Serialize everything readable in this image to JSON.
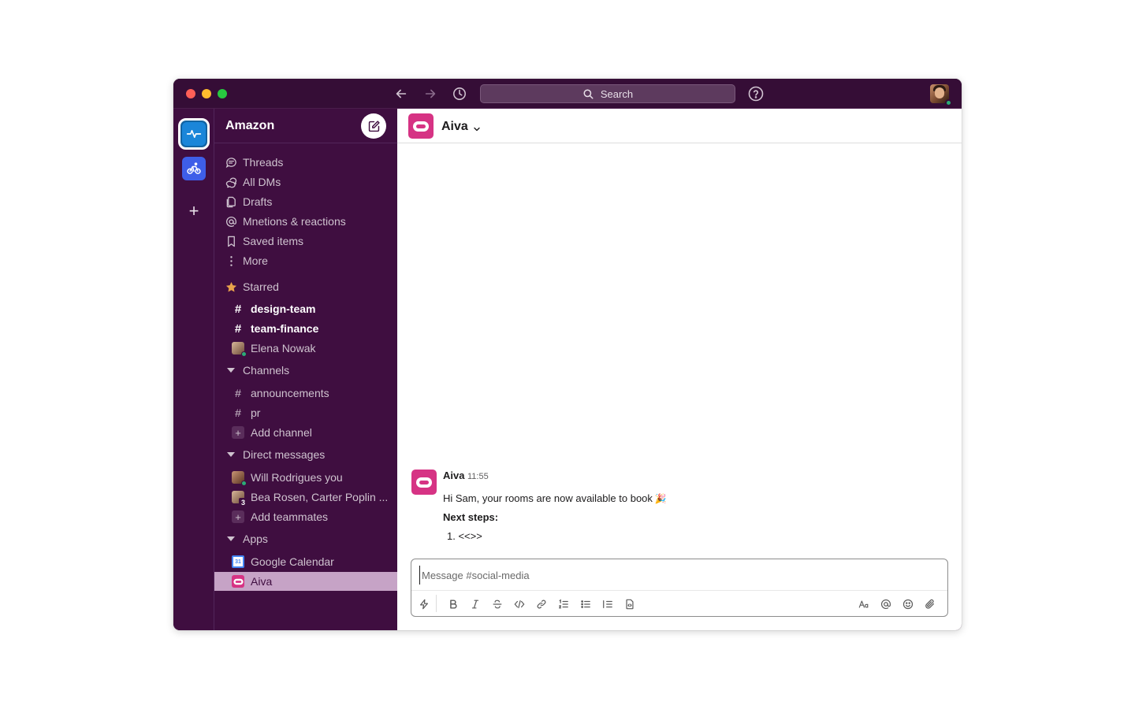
{
  "titlebar": {
    "search_label": "Search"
  },
  "sidebar": {
    "workspace_name": "Amazon",
    "nav": [
      {
        "label": "Threads",
        "icon": "threads-icon"
      },
      {
        "label": "All DMs",
        "icon": "dms-icon"
      },
      {
        "label": "Drafts",
        "icon": "drafts-icon"
      },
      {
        "label": "Mnetions & reactions",
        "icon": "mention-icon"
      },
      {
        "label": "Saved items",
        "icon": "bookmark-icon"
      },
      {
        "label": "More",
        "icon": "more-icon"
      }
    ],
    "starred": {
      "label": "Starred",
      "items": [
        {
          "label": "design-team",
          "prefix": "#"
        },
        {
          "label": "team-finance",
          "prefix": "#"
        },
        {
          "label": "Elena Nowak"
        }
      ]
    },
    "channels": {
      "label": "Channels",
      "items": [
        {
          "label": "announcements",
          "prefix": "#"
        },
        {
          "label": "pr",
          "prefix": "#"
        }
      ],
      "add_label": "Add channel"
    },
    "direct_messages": {
      "label": "Direct messages",
      "items": [
        {
          "label": "Will Rodrigues you"
        },
        {
          "label": "Bea Rosen, Carter Poplin ...",
          "count": "3"
        }
      ],
      "add_label": "Add teammates"
    },
    "apps": {
      "label": "Apps",
      "items": [
        {
          "label": "Google Calendar",
          "icon_text": "31"
        },
        {
          "label": "Aiva"
        }
      ]
    }
  },
  "channel": {
    "title": "Aiva"
  },
  "message": {
    "author": "Aiva",
    "time": "11:55",
    "text": "Hi Sam, your rooms are now available to book",
    "emoji": "🎉",
    "next_steps": "Next steps:",
    "list_item": "1.  <<>>"
  },
  "composer": {
    "placeholder": "Message #social-media",
    "tools": [
      "shortcuts-icon",
      "bold-icon",
      "italic-icon",
      "strikethrough-icon",
      "code-icon",
      "link-icon",
      "ordered-list-icon",
      "bulleted-list-icon",
      "numbered-list-icon",
      "code-block-icon",
      "formatting-icon",
      "mention-icon",
      "emoji-icon",
      "attachment-icon"
    ]
  },
  "colors": {
    "aubergine": "#3f0e40",
    "titlebar": "#350d36",
    "selected": "#c6a3c6",
    "aiva_pink": "#d63384",
    "presence": "#2bac76"
  }
}
